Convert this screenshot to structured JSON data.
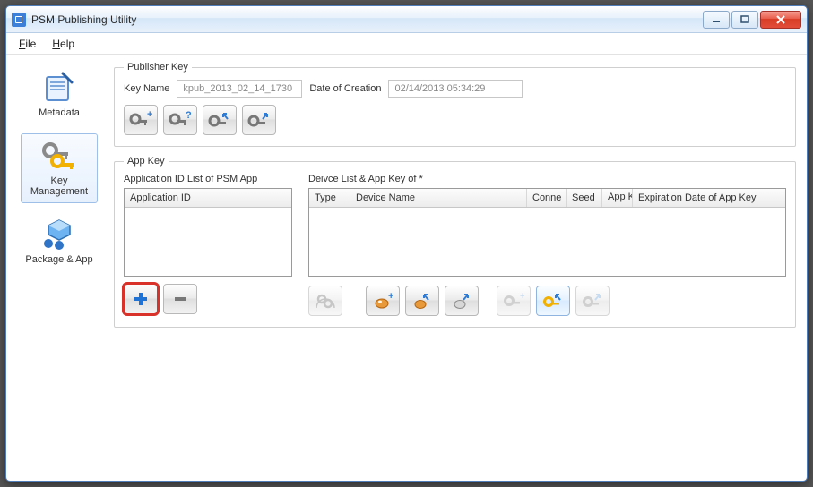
{
  "window": {
    "title": "PSM Publishing Utility"
  },
  "menu": {
    "file": "File",
    "help": "Help"
  },
  "sidebar": {
    "items": [
      {
        "label": "Metadata"
      },
      {
        "label": "Key Management"
      },
      {
        "label": "Package & App"
      }
    ]
  },
  "publisherKey": {
    "legend": "Publisher Key",
    "keyNameLabel": "Key Name",
    "keyNameValue": "kpub_2013_02_14_1730",
    "dateLabel": "Date of Creation",
    "dateValue": "02/14/2013 05:34:29"
  },
  "appKey": {
    "legend": "App Key",
    "leftLabel": "Application ID List of PSM App",
    "leftCols": {
      "appId": "Application ID"
    },
    "rightLabel": "Deivce List & App Key of *",
    "rightCols": {
      "type": "Type",
      "device": "Device Name",
      "conne": "Conne",
      "seed": "Seed",
      "appkey": "App Key",
      "exp": "Expiration Date of App Key"
    }
  }
}
